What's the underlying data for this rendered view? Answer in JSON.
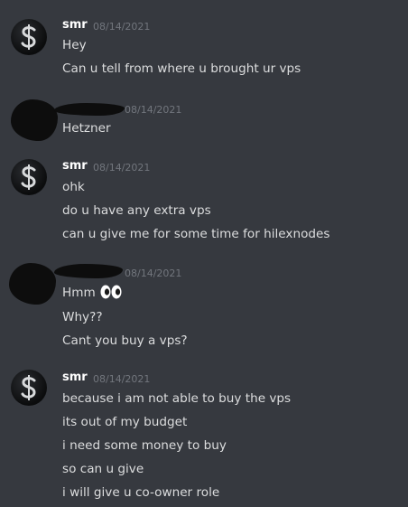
{
  "messages": [
    {
      "author": "smr",
      "date": "08/14/2021",
      "lines": [
        "Hey",
        "Can u tell from where u brought ur vps"
      ]
    },
    {
      "author": "",
      "date": "08/14/2021",
      "lines": [
        "Hetzner"
      ]
    },
    {
      "author": "smr",
      "date": "08/14/2021",
      "lines": [
        "ohk",
        "do u have any extra vps",
        "can u give me for some time for hilexnodes"
      ]
    },
    {
      "author": "",
      "date": "08/14/2021",
      "lines": [
        "Hmm",
        "Why??",
        "Cant you buy a vps?"
      ],
      "emoji": "eyes-emoji"
    },
    {
      "author": "smr",
      "date": "08/14/2021",
      "lines": [
        "because i am not able to buy the vps",
        "its out of my budget",
        "i need some money to buy",
        "so can u give",
        "i will give u co-owner role"
      ]
    }
  ]
}
